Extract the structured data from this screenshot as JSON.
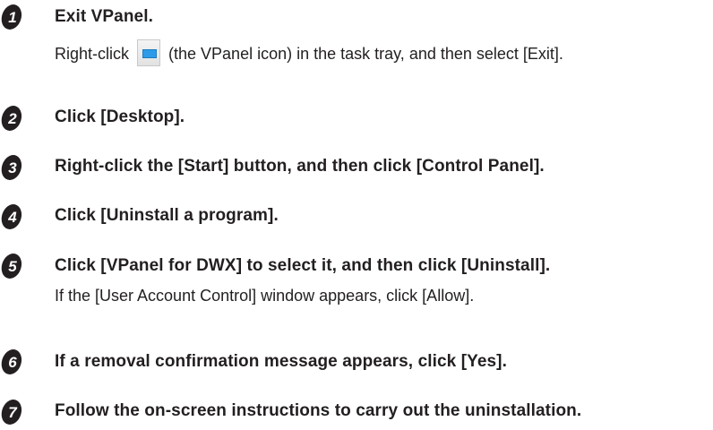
{
  "steps": [
    {
      "number": "1",
      "title": "Exit VPanel.",
      "note_before_icon": "Right-click",
      "note_icon": "vpanel-tray-icon",
      "note_after_icon": "(the VPanel icon) in the task tray, and then select [Exit]."
    },
    {
      "number": "2",
      "title": "Click [Desktop]."
    },
    {
      "number": "3",
      "title": "Right-click the [Start] button, and then click [Control Panel]."
    },
    {
      "number": "4",
      "title": "Click [Uninstall a program]."
    },
    {
      "number": "5",
      "title": "Click [VPanel for DWX] to select it, and then click [Uninstall].",
      "note": "If the [User Account Control] window appears, click [Allow]."
    },
    {
      "number": "6",
      "title": "If a removal confirmation message appears, click [Yes]."
    },
    {
      "number": "7",
      "title": "Follow the on-screen instructions to carry out the uninstallation."
    }
  ],
  "colors": {
    "badge": "#231f20",
    "text": "#231f20",
    "icon_blue": "#2d9be8"
  }
}
